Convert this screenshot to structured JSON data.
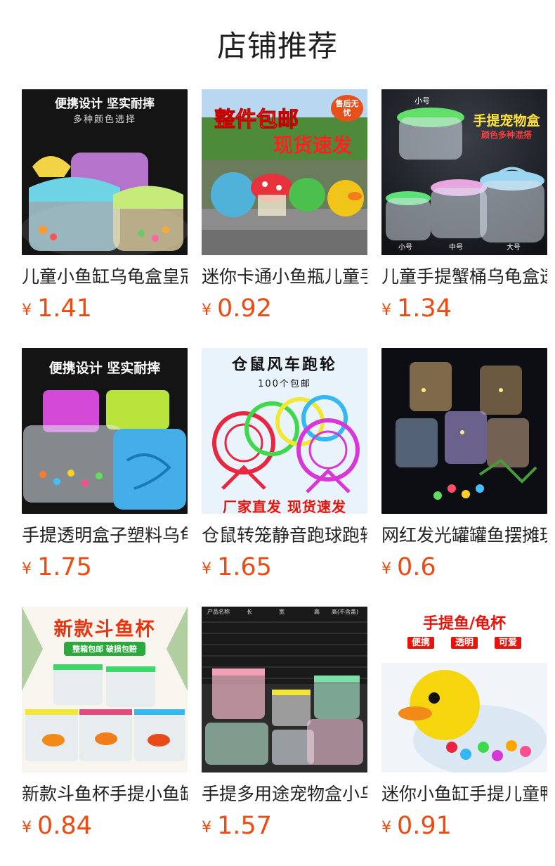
{
  "section": {
    "title": "店铺推荐"
  },
  "colors": {
    "price": "#ee4a12",
    "title": "#1f1f1f"
  },
  "products": [
    {
      "name": "儿童小鱼缸乌龟盒皇冠手提",
      "currency": "¥",
      "price": "1.41",
      "image": {
        "icon": "crown-lid-fish-boxes-image",
        "texts": [
          "便携设计 坚实耐摔",
          "多种颜色选择"
        ]
      }
    },
    {
      "name": "迷你卡通小鱼瓶儿童手提",
      "currency": "¥",
      "price": "0.92",
      "image": {
        "icon": "cartoon-fish-bottles-image",
        "texts": [
          "整件包邮",
          "现货速发",
          "售后无忧"
        ]
      }
    },
    {
      "name": "儿童手提蟹桶乌龟盒透明",
      "currency": "¥",
      "price": "1.34",
      "image": {
        "icon": "handle-pet-box-image",
        "texts": [
          "手提宠物盒",
          "颜色多种混搭",
          "小号",
          "小号",
          "中号",
          "大号"
        ]
      }
    },
    {
      "name": "手提透明盒子塑料乌龟盒",
      "currency": "¥",
      "price": "1.75",
      "image": {
        "icon": "square-plastic-boxes-image",
        "texts": [
          "便携设计 坚实耐摔"
        ]
      }
    },
    {
      "name": "仓鼠转笼静音跑球跑轮玩具",
      "currency": "¥",
      "price": "1.65",
      "image": {
        "icon": "hamster-wheel-image",
        "texts": [
          "仓鼠风车跑轮",
          "100个包邮",
          "厂家直发 现货速发"
        ]
      }
    },
    {
      "name": "网红发光罐罐鱼摆摊玩具",
      "currency": "¥",
      "price": "0.6",
      "image": {
        "icon": "glowing-jars-image",
        "texts": []
      }
    },
    {
      "name": "新款斗鱼杯手提小鱼缸",
      "currency": "¥",
      "price": "0.84",
      "image": {
        "icon": "betta-cups-image",
        "texts": [
          "新款斗鱼杯",
          "整箱包邮 破损包赔"
        ]
      }
    },
    {
      "name": "手提多用途宠物盒小乌龟",
      "currency": "¥",
      "price": "1.57",
      "image": {
        "icon": "multipurpose-pet-box-image",
        "texts": [
          "产品名称",
          "长",
          "宽",
          "高",
          "高(不含盖)"
        ]
      }
    },
    {
      "name": "迷你小鱼缸手提儿童鸭子",
      "currency": "¥",
      "price": "0.91",
      "image": {
        "icon": "duck-fish-cup-image",
        "texts": [
          "手提鱼/龟杯",
          "便携",
          "透明",
          "可爱"
        ]
      }
    }
  ]
}
